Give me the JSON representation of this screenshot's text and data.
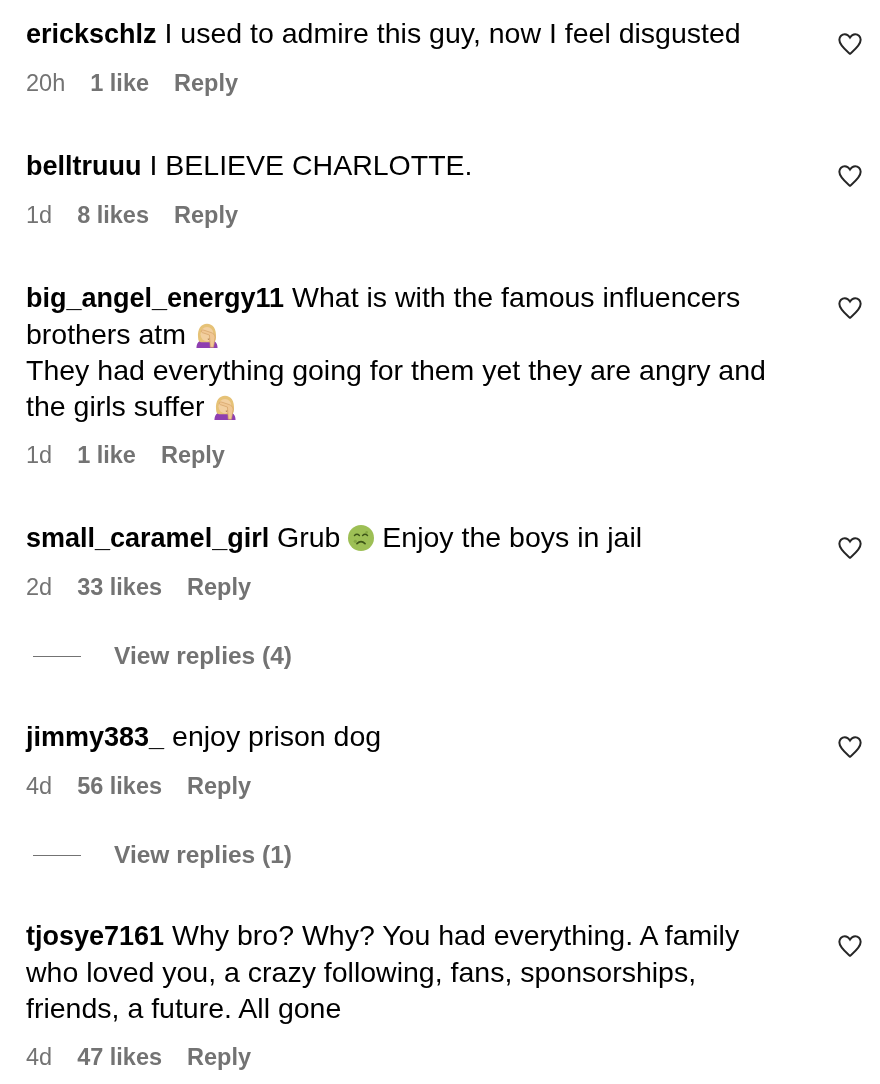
{
  "comments": [
    {
      "username": "erickschlz",
      "body": [
        {
          "kind": "text",
          "text": "I used to admire this guy, now I feel disgusted"
        }
      ],
      "time": "20h",
      "likes": "1 like",
      "reply": "Reply",
      "liked": false
    },
    {
      "username": "belltruuu",
      "body": [
        {
          "kind": "text",
          "text": "I BELIEVE CHARLOTTE."
        }
      ],
      "time": "1d",
      "likes": "8 likes",
      "reply": "Reply",
      "liked": false
    },
    {
      "username": "big_angel_energy11",
      "body": [
        {
          "kind": "text",
          "text": "What is with the famous influencers brothers atm"
        },
        {
          "kind": "facepalm"
        },
        {
          "kind": "text",
          "text": "\nThey had everything going for them yet they are angry and the girls suffer"
        },
        {
          "kind": "facepalm"
        }
      ],
      "time": "1d",
      "likes": "1 like",
      "reply": "Reply",
      "liked": false
    },
    {
      "username": "small_caramel_girl",
      "body": [
        {
          "kind": "text",
          "text": "Grub"
        },
        {
          "kind": "nauseated"
        },
        {
          "kind": "text",
          "text": "Enjoy the boys in jail"
        }
      ],
      "time": "2d",
      "likes": "33 likes",
      "reply": "Reply",
      "liked": false,
      "view_replies": "View replies (4)"
    },
    {
      "username": "jimmy383_",
      "body": [
        {
          "kind": "text",
          "text": "enjoy prison dog"
        }
      ],
      "time": "4d",
      "likes": "56 likes",
      "reply": "Reply",
      "liked": false,
      "view_replies": "View replies (1)"
    },
    {
      "username": "tjosye7161",
      "body": [
        {
          "kind": "text",
          "text": "Why bro? Why? You had everything. A family who loved you, a crazy following, fans, sponsorships, friends, a future. All gone"
        }
      ],
      "time": "4d",
      "likes": "47 likes",
      "reply": "Reply",
      "liked": false
    }
  ]
}
